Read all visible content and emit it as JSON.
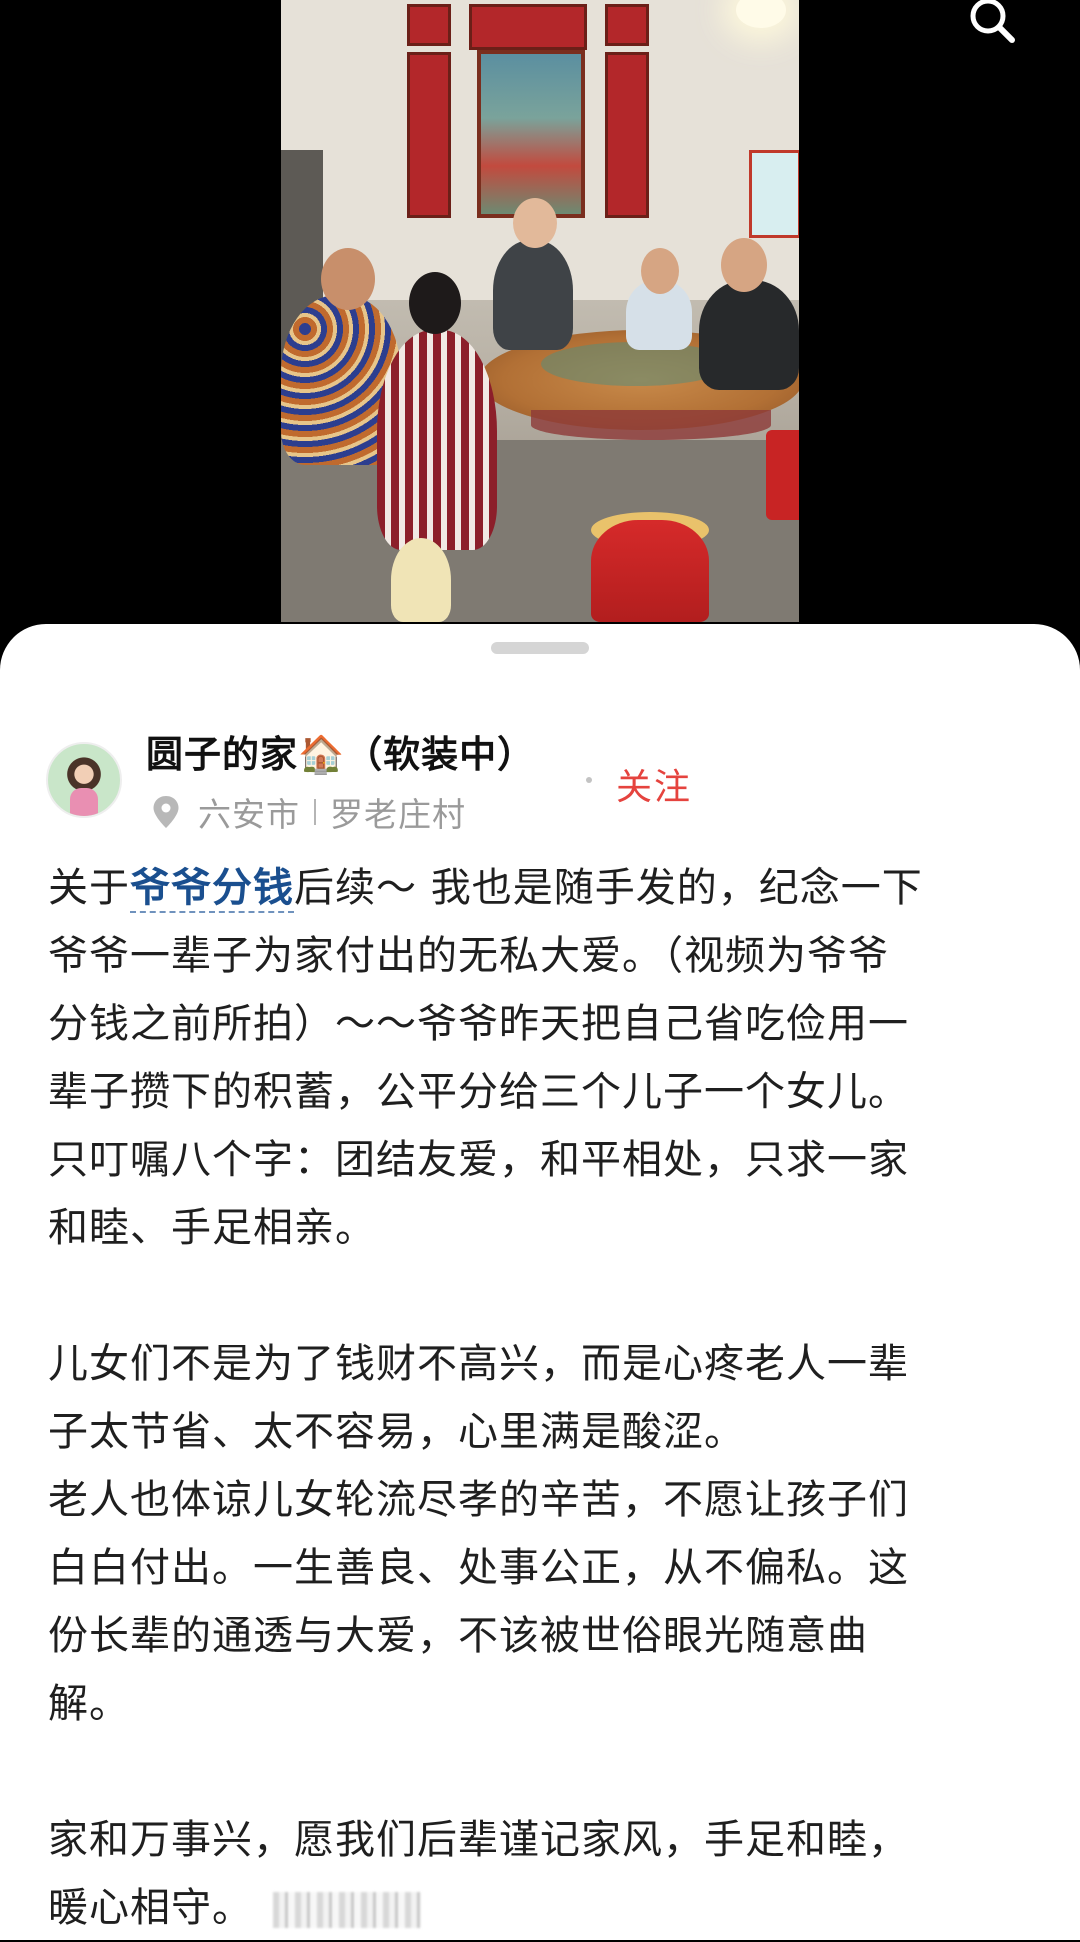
{
  "icons": {
    "search": "search-icon",
    "location": "location-pin-icon",
    "house_emoji": "🏠"
  },
  "author": {
    "name": "圆子的家",
    "name_suffix": "（软装中）"
  },
  "location": {
    "city": "六安市",
    "village": "罗老庄村"
  },
  "follow_label": "关注",
  "post": {
    "line1_prefix": "关于",
    "hashtag": "爷爷分钱",
    "line1_suffix": "后续～ 我也是随手发的，纪念一下",
    "lines_para1": [
      "爷爷一辈子为家付出的无私大爱。（视频为爷爷",
      "分钱之前所拍）～～爷爷昨天把自己省吃俭用一",
      "辈子攒下的积蓄，公平分给三个儿子一个女儿。",
      "只叮嘱八个字：团结友爱，和平相处，只求一家",
      "和睦、手足相亲。"
    ],
    "lines_para2": [
      "儿女们不是为了钱财不高兴，而是心疼老人一辈",
      "子太节省、太不容易，心里满是酸涩。",
      "老人也体谅儿女轮流尽孝的辛苦，不愿让孩子们",
      "白白付出。一生善良、处事公正，从不偏私。这",
      "份长辈的通透与大爱，不该被世俗眼光随意曲",
      "解。"
    ],
    "lines_para3": [
      "家和万事兴，愿我们后辈谨记家风，手足和睦，",
      "暖心相守。"
    ]
  },
  "colors": {
    "hashtag": "#1a4f8f",
    "follow": "#e5433e",
    "location_text": "#9a9a9a",
    "body_text": "#1f1f1f"
  }
}
